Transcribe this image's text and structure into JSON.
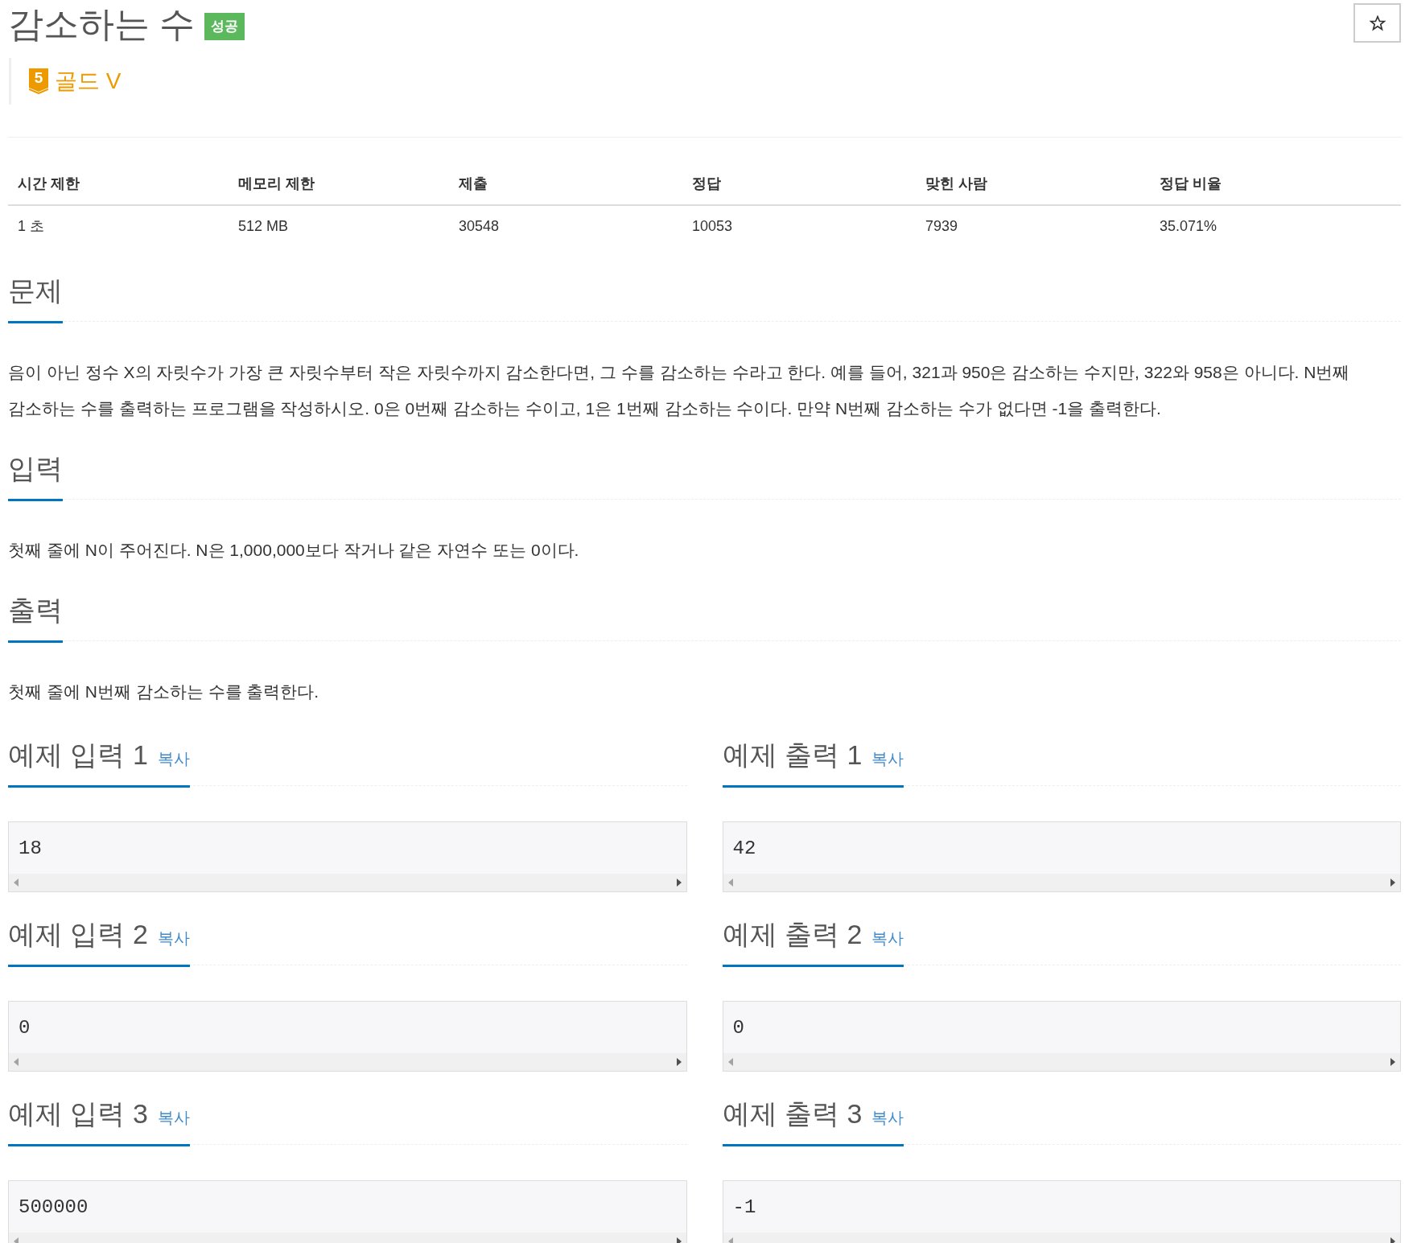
{
  "title": "감소하는 수",
  "result_badge": "성공",
  "starred": false,
  "tier": {
    "number": "5",
    "label": "골드 V"
  },
  "stats": {
    "columns": [
      "시간 제한",
      "메모리 제한",
      "제출",
      "정답",
      "맞힌 사람",
      "정답 비율"
    ],
    "row": [
      "1 초",
      "512 MB",
      "30548",
      "10053",
      "7939",
      "35.071%"
    ]
  },
  "sections": [
    {
      "heading": "문제",
      "paragraphs": [
        "음이 아닌 정수 X의 자릿수가 가장 큰 자릿수부터 작은 자릿수까지 감소한다면, 그 수를 감소하는 수라고 한다. 예를 들어, 321과 950은 감소하는 수지만, 322와 958은 아니다. N번째 감소하는 수를 출력하는 프로그램을 작성하시오. 0은 0번째 감소하는 수이고, 1은 1번째 감소하는 수이다. 만약 N번째 감소하는 수가 없다면 -1을 출력한다."
      ]
    },
    {
      "heading": "입력",
      "paragraphs": [
        "첫째 줄에 N이 주어진다. N은 1,000,000보다 작거나 같은 자연수 또는 0이다."
      ]
    },
    {
      "heading": "출력",
      "paragraphs": [
        "첫째 줄에 N번째 감소하는 수를 출력한다."
      ]
    }
  ],
  "samples": [
    {
      "input": {
        "title": "예제 입력 1",
        "copy": "복사",
        "content": "18"
      },
      "output": {
        "title": "예제 출력 1",
        "copy": "복사",
        "content": "42"
      }
    },
    {
      "input": {
        "title": "예제 입력 2",
        "copy": "복사",
        "content": "0"
      },
      "output": {
        "title": "예제 출력 2",
        "copy": "복사",
        "content": "0"
      }
    },
    {
      "input": {
        "title": "예제 입력 3",
        "copy": "복사",
        "content": "500000"
      },
      "output": {
        "title": "예제 출력 3",
        "copy": "복사",
        "content": "-1"
      }
    }
  ]
}
